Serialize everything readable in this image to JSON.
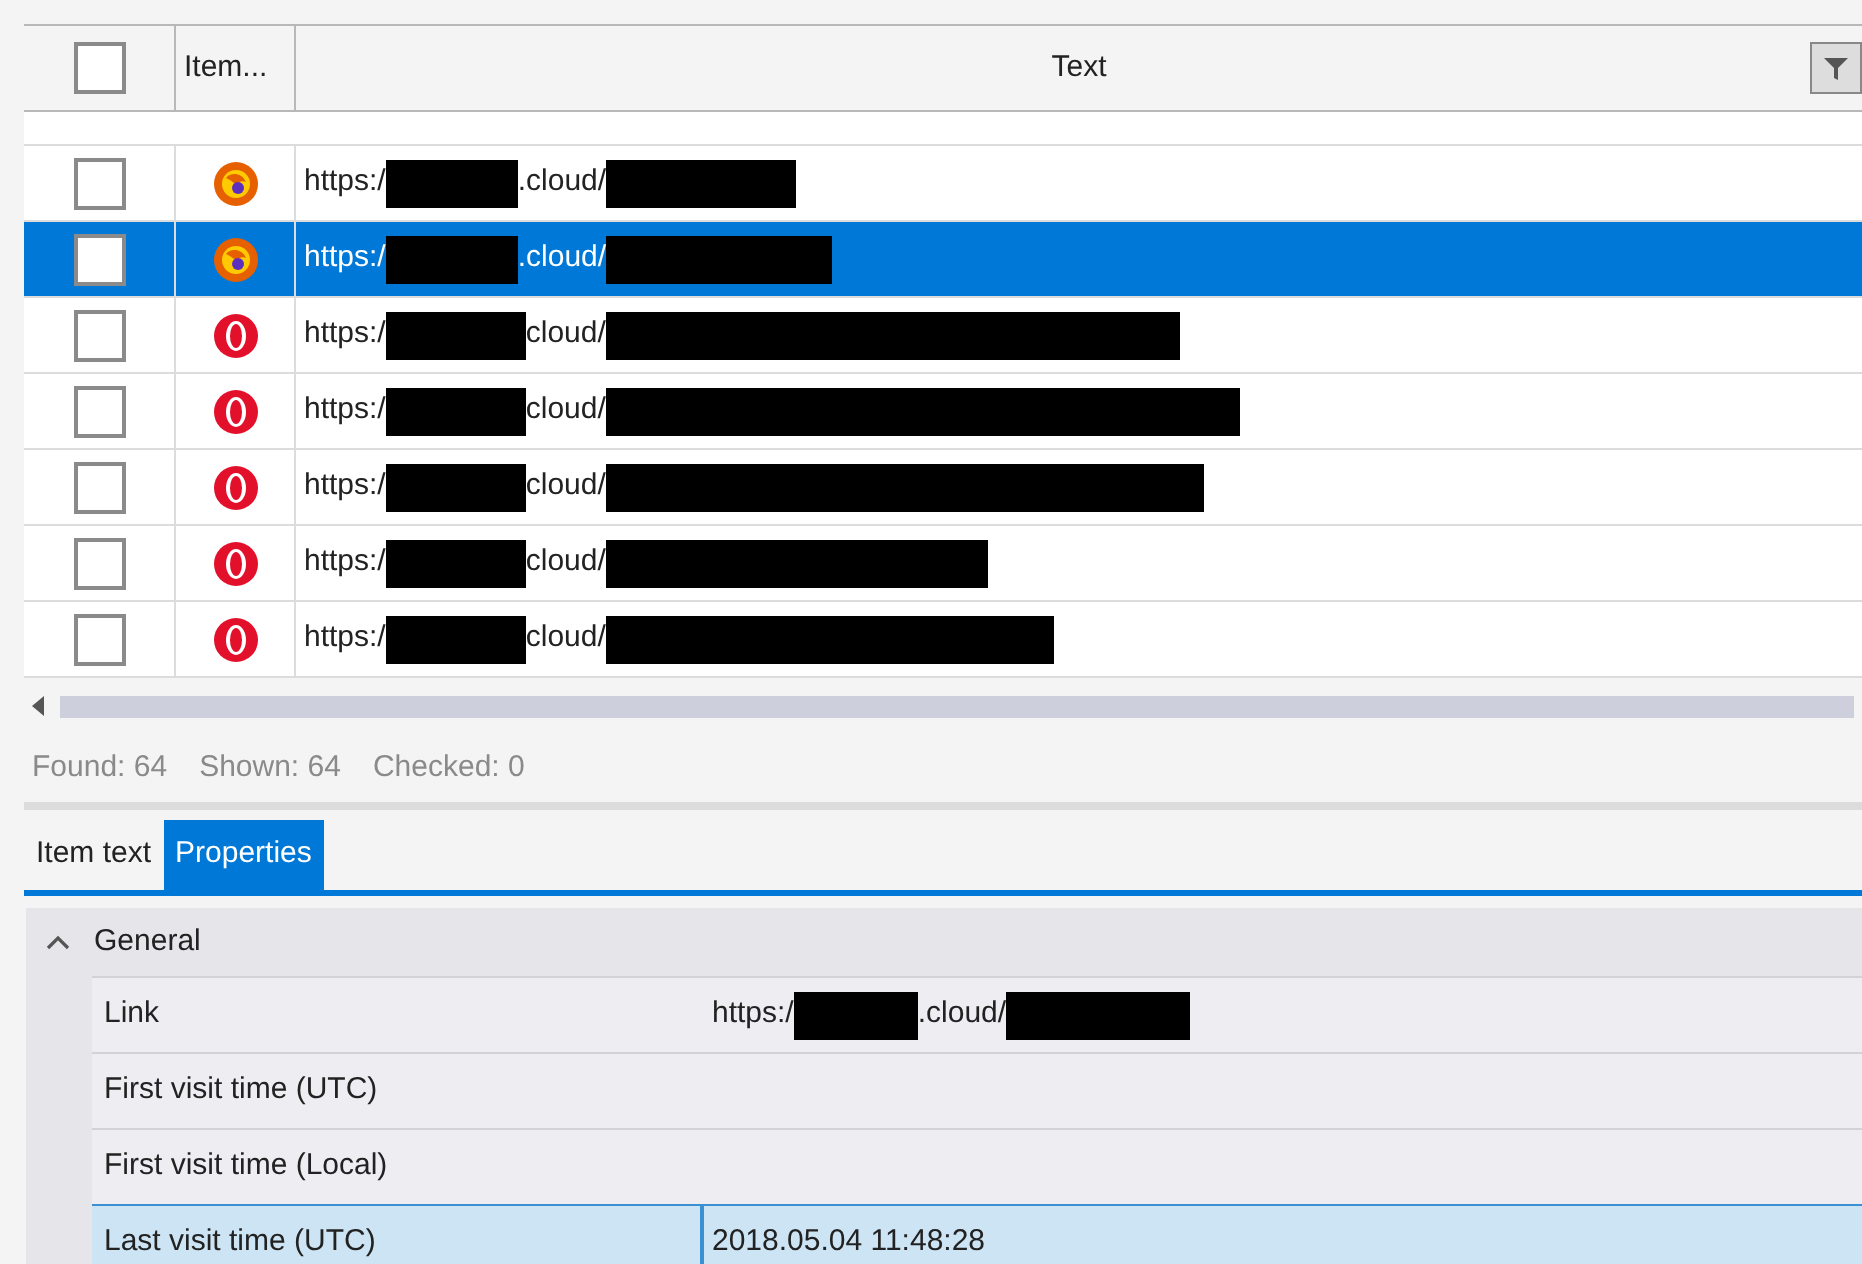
{
  "table": {
    "header_checked": false,
    "columns": [
      "Item...",
      "Text"
    ],
    "rows": [
      {
        "checked": false,
        "selected": false,
        "kind": "firefox",
        "url": [
          {
            "kind": "text",
            "text": "https:/"
          },
          {
            "kind": "redacted"
          },
          {
            "kind": "text",
            "text": ".cloud/"
          },
          {
            "kind": "redacted"
          }
        ]
      },
      {
        "checked": false,
        "selected": true,
        "kind": "firefox",
        "url": [
          {
            "kind": "text",
            "text": "https:/"
          },
          {
            "kind": "redacted"
          },
          {
            "kind": "text",
            "text": ".cloud/"
          },
          {
            "kind": "redacted"
          }
        ]
      },
      {
        "checked": false,
        "selected": false,
        "kind": "opera",
        "url": [
          {
            "kind": "text",
            "text": "https:/"
          },
          {
            "kind": "redacted"
          },
          {
            "kind": "text",
            "text": "cloud/"
          },
          {
            "kind": "redacted"
          }
        ]
      },
      {
        "checked": false,
        "selected": false,
        "kind": "opera",
        "url": [
          {
            "kind": "text",
            "text": "https:/"
          },
          {
            "kind": "redacted"
          },
          {
            "kind": "text",
            "text": "cloud/"
          },
          {
            "kind": "redacted"
          }
        ]
      },
      {
        "checked": false,
        "selected": false,
        "kind": "opera",
        "url": [
          {
            "kind": "text",
            "text": "https:/"
          },
          {
            "kind": "redacted"
          },
          {
            "kind": "text",
            "text": "cloud/"
          },
          {
            "kind": "redacted"
          }
        ]
      },
      {
        "checked": false,
        "selected": false,
        "kind": "opera",
        "url": [
          {
            "kind": "text",
            "text": "https:/"
          },
          {
            "kind": "redacted"
          },
          {
            "kind": "text",
            "text": "cloud/"
          },
          {
            "kind": "redacted"
          }
        ]
      },
      {
        "checked": false,
        "selected": false,
        "kind": "opera",
        "url": [
          {
            "kind": "text",
            "text": "https:/"
          },
          {
            "kind": "redacted"
          },
          {
            "kind": "text",
            "text": "cloud/"
          },
          {
            "kind": "redacted"
          }
        ]
      }
    ]
  },
  "status_bar": [
    "Found: 64",
    "Shown: 64",
    "Checked: 0"
  ],
  "tabs": [
    {
      "label": "Item text",
      "selected": false
    },
    {
      "label": "Properties",
      "selected": true
    }
  ],
  "properties": {
    "group": "General",
    "expanded": true,
    "rows": [
      {
        "name": "Link",
        "selected": false,
        "value": [
          {
            "kind": "text",
            "text": "https:/"
          },
          {
            "kind": "redacted"
          },
          {
            "kind": "text",
            "text": ".cloud/"
          },
          {
            "kind": "redacted"
          }
        ]
      },
      {
        "name": "First visit time (UTC)",
        "selected": false,
        "value": []
      },
      {
        "name": "First visit time (Local)",
        "selected": false,
        "value": []
      },
      {
        "name": "Last visit time (UTC)",
        "selected": true,
        "value": [
          {
            "kind": "text",
            "text": "2018.05.04 11:48:28"
          }
        ]
      }
    ]
  }
}
